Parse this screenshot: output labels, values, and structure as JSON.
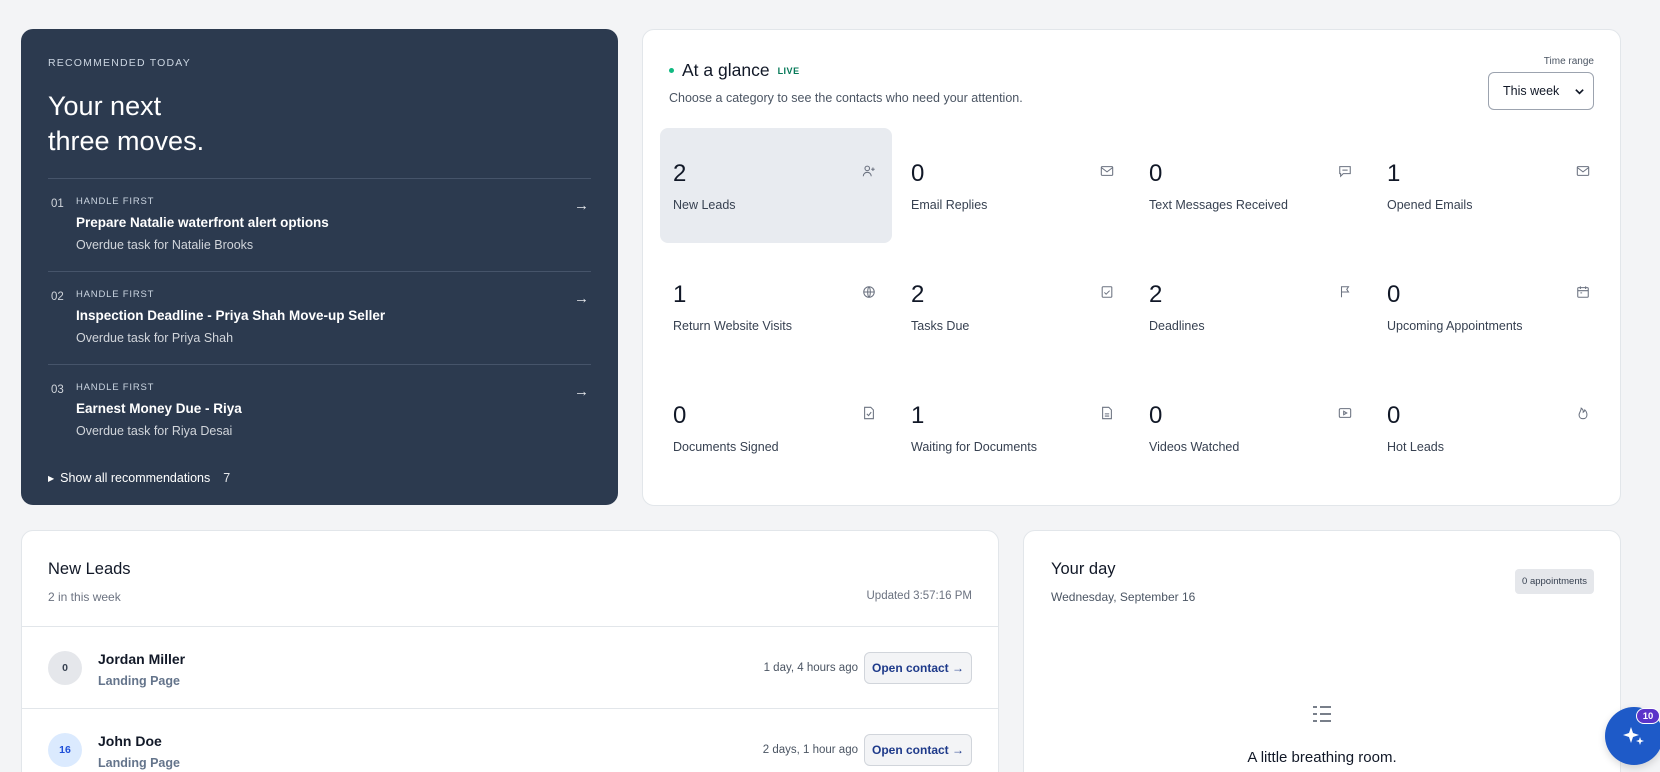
{
  "recommended": {
    "eyebrow": "RECOMMENDED TODAY",
    "heading_line1": "Your next",
    "heading_line2": "three moves.",
    "items": [
      {
        "num": "01",
        "kicker": "HANDLE FIRST",
        "title": "Prepare Natalie waterfront alert options",
        "subtitle": "Overdue task for Natalie Brooks",
        "arrow": "→"
      },
      {
        "num": "02",
        "kicker": "HANDLE FIRST",
        "title": "Inspection Deadline - Priya Shah Move-up Seller",
        "subtitle": "Overdue task for Priya Shah",
        "arrow": "→"
      },
      {
        "num": "03",
        "kicker": "HANDLE FIRST",
        "title": "Earnest Money Due - Riya",
        "subtitle": "Overdue task for Riya Desai",
        "arrow": "→"
      }
    ],
    "show_all_label": "Show all recommendations",
    "show_all_count": "7"
  },
  "glance": {
    "title": "At a glance",
    "live_badge": "LIVE",
    "description": "Choose a category to see the contacts who need your attention.",
    "time_range_label": "Time range",
    "time_range_value": "This week",
    "tiles": [
      {
        "value": "2",
        "label": "New Leads",
        "icon": "add-user-icon",
        "active": true
      },
      {
        "value": "0",
        "label": "Email Replies",
        "icon": "mail-icon"
      },
      {
        "value": "0",
        "label": "Text Messages Received",
        "icon": "chat-icon"
      },
      {
        "value": "1",
        "label": "Opened Emails",
        "icon": "mail-icon"
      },
      {
        "value": "1",
        "label": "Return Website Visits",
        "icon": "globe-icon"
      },
      {
        "value": "2",
        "label": "Tasks Due",
        "icon": "checklist-icon"
      },
      {
        "value": "2",
        "label": "Deadlines",
        "icon": "flag-icon"
      },
      {
        "value": "0",
        "label": "Upcoming Appointments",
        "icon": "calendar-icon"
      },
      {
        "value": "0",
        "label": "Documents Signed",
        "icon": "document-check-icon"
      },
      {
        "value": "1",
        "label": "Waiting for Documents",
        "icon": "document-icon"
      },
      {
        "value": "0",
        "label": "Videos Watched",
        "icon": "video-icon"
      },
      {
        "value": "0",
        "label": "Hot Leads",
        "icon": "flame-icon"
      }
    ]
  },
  "new_leads": {
    "title": "New Leads",
    "subtitle": "2 in this week",
    "updated": "Updated 3:57:16 PM",
    "rows": [
      {
        "badge": "0",
        "name": "Jordan Miller",
        "source": "Landing Page",
        "ago": "1 day, 4 hours ago",
        "action": "Open contact →"
      },
      {
        "badge": "16",
        "name": "John Doe",
        "source": "Landing Page",
        "ago": "2 days, 1 hour ago",
        "action": "Open contact →"
      }
    ]
  },
  "your_day": {
    "title": "Your day",
    "date": "Wednesday, September 16",
    "appointments_pill": "0 appointments",
    "empty_text": "A little breathing room."
  },
  "fab": {
    "badge": "10",
    "icon": "sparkle-icon"
  },
  "colors": {
    "panel_dark": "#2c3a4f",
    "accent_green": "#10b981",
    "link_blue": "#1e3a8a",
    "fab_blue": "#1e5ac8",
    "fab_badge": "#5b34c9"
  }
}
